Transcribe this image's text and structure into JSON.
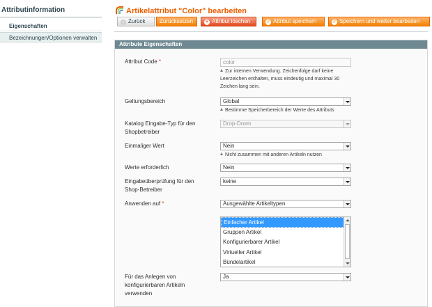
{
  "sidebar": {
    "title": "Attributinformation",
    "items": [
      {
        "label": "Eigenschaften"
      },
      {
        "label": "Bezeichnungen/Optionen verwalten"
      }
    ]
  },
  "header": {
    "title": "Artikelattribut \"Color\" bearbeiten",
    "buttons": {
      "back": "Zurück",
      "reset": "Zurücksetzen",
      "delete": "Attribut löschen",
      "save": "Attribut speichern",
      "save_continue": "Speichern und weiter bearbeiten"
    }
  },
  "fieldset": {
    "title": "Attribute Eigenschaften",
    "fields": {
      "attribute_code": {
        "label": "Attribut Code",
        "required_mark": "*",
        "value": "color",
        "note": "Zur internen Verwendung. Zeichenfolge darf keine Leerzeichen enthalten, muss eindeutig und maximal 30 Zeichen lang sein."
      },
      "scope": {
        "label": "Geltungsbereich",
        "value": "Global",
        "note": "Bestimme Speicherbereich der Werte des Attributs"
      },
      "input_type": {
        "label": "Katalog Eingabe-Typ für den Shopbetreiber",
        "value": "Drop-Down"
      },
      "unique": {
        "label": "Einmaliger Wert",
        "value": "Nein",
        "note": "Nicht zusammen mit anderen Artikeln nutzen"
      },
      "required": {
        "label": "Werte erforderlich",
        "value": "Nein"
      },
      "validation": {
        "label": "Eingabeüberprüfung für den Shop-Betreiber",
        "value": "keine"
      },
      "apply_to": {
        "label": "Anwenden auf",
        "required_mark": "*",
        "value": "Ausgewählte Artikeltypen",
        "options": [
          {
            "label": "Einfacher Artikel",
            "selected": true
          },
          {
            "label": "Gruppen Artikel",
            "selected": false
          },
          {
            "label": "Konfigurierbarer Artikel",
            "selected": false
          },
          {
            "label": "Virtueller Artikel",
            "selected": false
          },
          {
            "label": "Bündelartikel",
            "selected": false
          }
        ]
      },
      "configurable": {
        "label": "Für das Anlegen von konfigurierbaren Artikeln verwenden",
        "value": "Ja"
      }
    }
  },
  "colors": {
    "accent": "#eb5e00",
    "button": "#f18200",
    "delete": "#e34a1c",
    "fieldset_head": "#6f8992",
    "selection": "#3399ff"
  }
}
